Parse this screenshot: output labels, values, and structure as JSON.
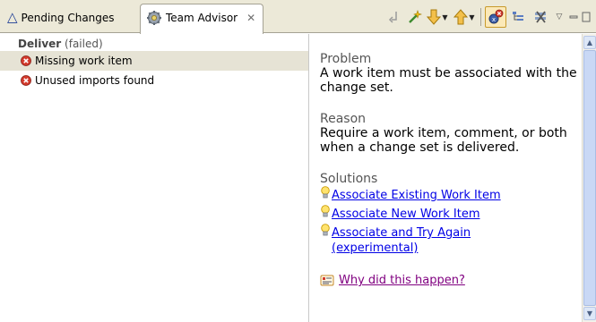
{
  "tabs": [
    {
      "label": "Pending Changes",
      "icon": "delta-icon",
      "active": false
    },
    {
      "label": "Team Advisor",
      "icon": "team-advisor-icon",
      "active": true
    }
  ],
  "toolbar": {
    "items": [
      "undo-icon",
      "wand-icon",
      "next-arrow-icon",
      "prev-arrow-icon",
      "error-filter-icon",
      "tree-layout-icon",
      "remove-all-icon",
      "view-menu-icon",
      "minimize-icon",
      "maximize-icon"
    ]
  },
  "left_pane": {
    "group_title": "Deliver",
    "group_status": "(failed)",
    "issues": [
      {
        "label": "Missing work item",
        "selected": true
      },
      {
        "label": "Unused imports found",
        "selected": false
      }
    ]
  },
  "detail": {
    "problem_title": "Problem",
    "problem_text": "A work item must be associated with the change set.",
    "reason_title": "Reason",
    "reason_text": "Require a work item, comment, or both when a change set is delivered.",
    "solutions_title": "Solutions",
    "solutions": [
      "Associate Existing Work Item",
      "Associate New Work Item",
      "Associate and Try Again (experimental)"
    ],
    "why_link": "Why did this happen?"
  },
  "colors": {
    "link": "#0000e6",
    "visited_link": "#800080",
    "error": "#d33a2c",
    "selected_row": "#e6e3d5",
    "chrome": "#ece9d8"
  }
}
